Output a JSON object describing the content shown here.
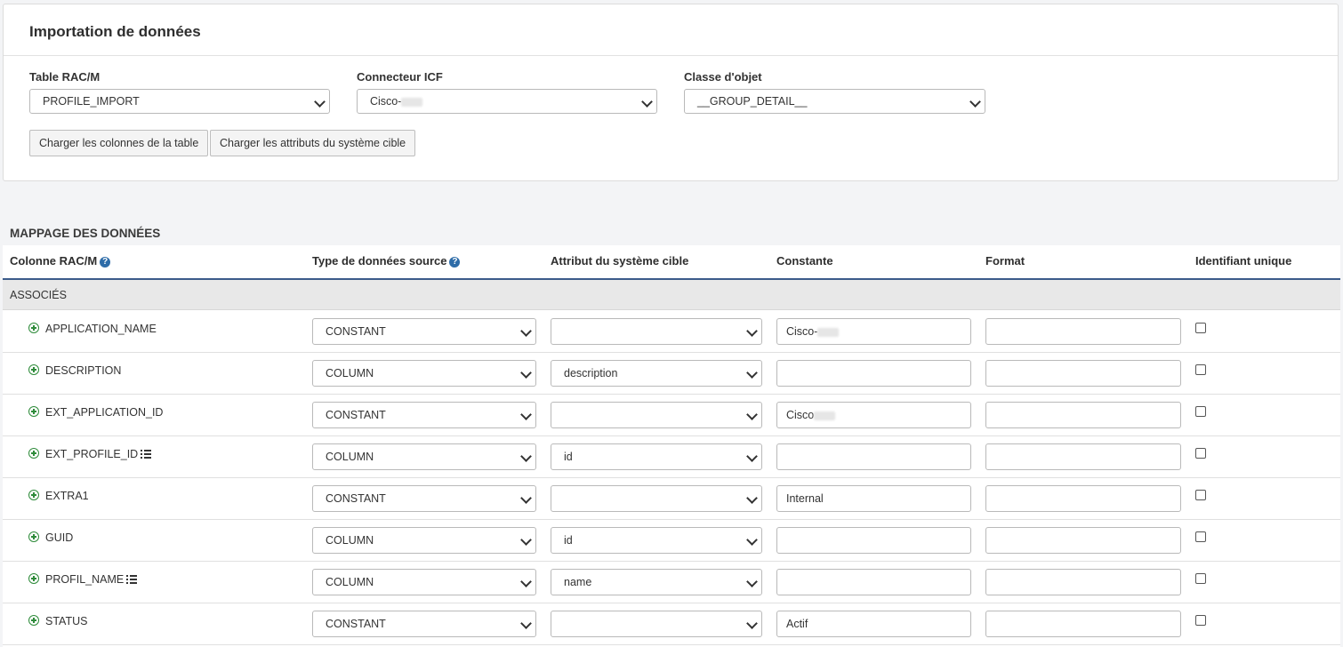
{
  "panel": {
    "title": "Importation de données",
    "fields": [
      {
        "label": "Table RAC/M",
        "value": "PROFILE_IMPORT"
      },
      {
        "label": "Connecteur ICF",
        "value": "Cisco-"
      },
      {
        "label": "Classe d'objet",
        "value": "__GROUP_DETAIL__"
      }
    ],
    "buttons": [
      "Charger les colonnes de la table",
      "Charger les attributs du système cible"
    ]
  },
  "mapping": {
    "section_title": "MAPPAGE DES DONNÉES",
    "headers": {
      "column": "Colonne RAC/M",
      "source_type": "Type de données source",
      "target_attr": "Attribut du système cible",
      "constant": "Constante",
      "format": "Format",
      "unique": "Identifiant unique"
    },
    "group_label": "ASSOCIÉS",
    "rows": [
      {
        "name": "APPLICATION_NAME",
        "type": "CONSTANT",
        "attr": "",
        "constant": "Cisco-",
        "format": "",
        "list": false,
        "blur": true
      },
      {
        "name": "DESCRIPTION",
        "type": "COLUMN",
        "attr": "description",
        "constant": "",
        "format": "",
        "list": false,
        "blur": false
      },
      {
        "name": "EXT_APPLICATION_ID",
        "type": "CONSTANT",
        "attr": "",
        "constant": "Cisco",
        "format": "",
        "list": false,
        "blur": true
      },
      {
        "name": "EXT_PROFILE_ID",
        "type": "COLUMN",
        "attr": "id",
        "constant": "",
        "format": "",
        "list": true,
        "blur": false
      },
      {
        "name": "EXTRA1",
        "type": "CONSTANT",
        "attr": "",
        "constant": "Internal",
        "format": "",
        "list": false,
        "blur": false
      },
      {
        "name": "GUID",
        "type": "COLUMN",
        "attr": "id",
        "constant": "",
        "format": "",
        "list": false,
        "blur": false
      },
      {
        "name": "PROFIL_NAME",
        "type": "COLUMN",
        "attr": "name",
        "constant": "",
        "format": "",
        "list": true,
        "blur": false
      },
      {
        "name": "STATUS",
        "type": "CONSTANT",
        "attr": "",
        "constant": "Actif",
        "format": "",
        "list": false,
        "blur": false
      }
    ]
  }
}
